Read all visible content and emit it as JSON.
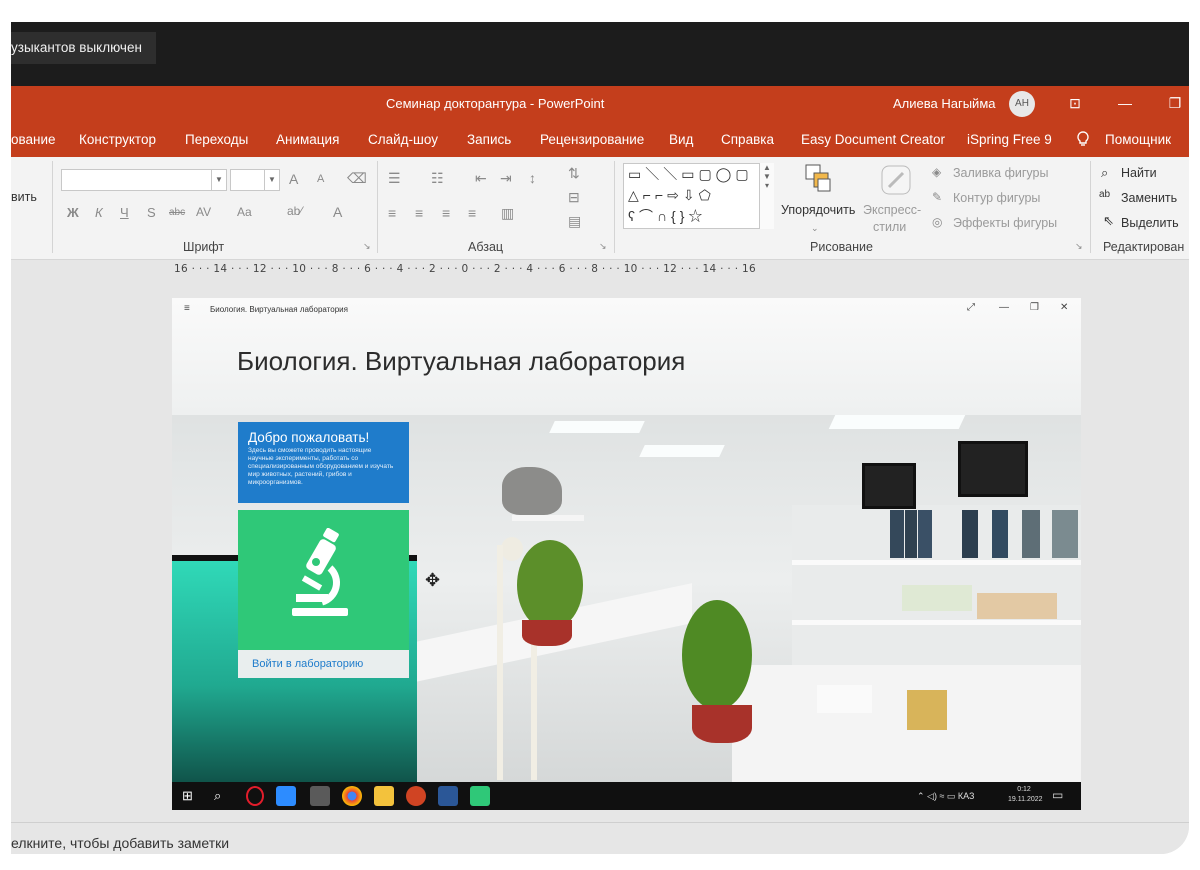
{
  "toast": {
    "text": "узыкантов выключен"
  },
  "powerpoint": {
    "title": "Семинар докторантура  -  PowerPoint",
    "user": "Алиева Нагыйма",
    "user_initials": "АН",
    "window_controls": {
      "ribbon_display": "⊡",
      "minimize": "—",
      "restore": "❐"
    }
  },
  "tabs": [
    "ование",
    "Конструктор",
    "Переходы",
    "Анимация",
    "Слайд-шоу",
    "Запись",
    "Рецензирование",
    "Вид",
    "Справка",
    "Easy Document Creator",
    "iSpring Free 9",
    "Помощник"
  ],
  "ribbon": {
    "clipboard_partial": "вить",
    "font_group_label": "Шрифт",
    "paragraph_group_label": "Абзац",
    "drawing_group_label": "Рисование",
    "editing_group_label": "Редактирован",
    "font_buttons": [
      "Ж",
      "К",
      "Ч",
      "S",
      "abc",
      "AV",
      "Aa"
    ],
    "grow_font": "A",
    "shrink_font": "A",
    "arrange_label": "Упорядочить",
    "quick_styles_label": "Экспресс-\nстили",
    "quick_styles_line1": "Экспресс-",
    "quick_styles_line2": "стили",
    "shape_fill": "Заливка фигуры",
    "shape_outline": "Контур фигуры",
    "shape_effects": "Эффекты фигуры",
    "find": "Найти",
    "replace": "Заменить",
    "select": "Выделить"
  },
  "ruler": {
    "text": "16 · · · 14 · · · 12 · · · 10 · · · 8 · · · 6 · · · 4 · · · 2 · · · 0 · · · 2 · · · 4 · · · 6 · · · 8 · · · 10 · · · 12 · · · 14 · · · 16"
  },
  "slide": {
    "app_title_small": "Биология. Виртуальная лаборатория",
    "app_title_big": "Биология. Виртуальная лаборатория",
    "welcome_heading": "Добро пожаловать!",
    "welcome_text": "Здесь вы сможете проводить настоящие научные эксперименты, работать со специализированным оборудованием и изучать мир животных, растений, грибов и микроорганизмов.",
    "enter_button": "Войти в лабораторию",
    "tray_lang": "КАЗ",
    "clock_time": "0:12",
    "clock_date": "19.11.2022"
  },
  "notes": {
    "placeholder": "елкните, чтобы добавить заметки"
  },
  "colors": {
    "ppt_accent": "#c43e1c",
    "welcome_blue": "#1f7ccb",
    "micro_green": "#2fc878"
  }
}
